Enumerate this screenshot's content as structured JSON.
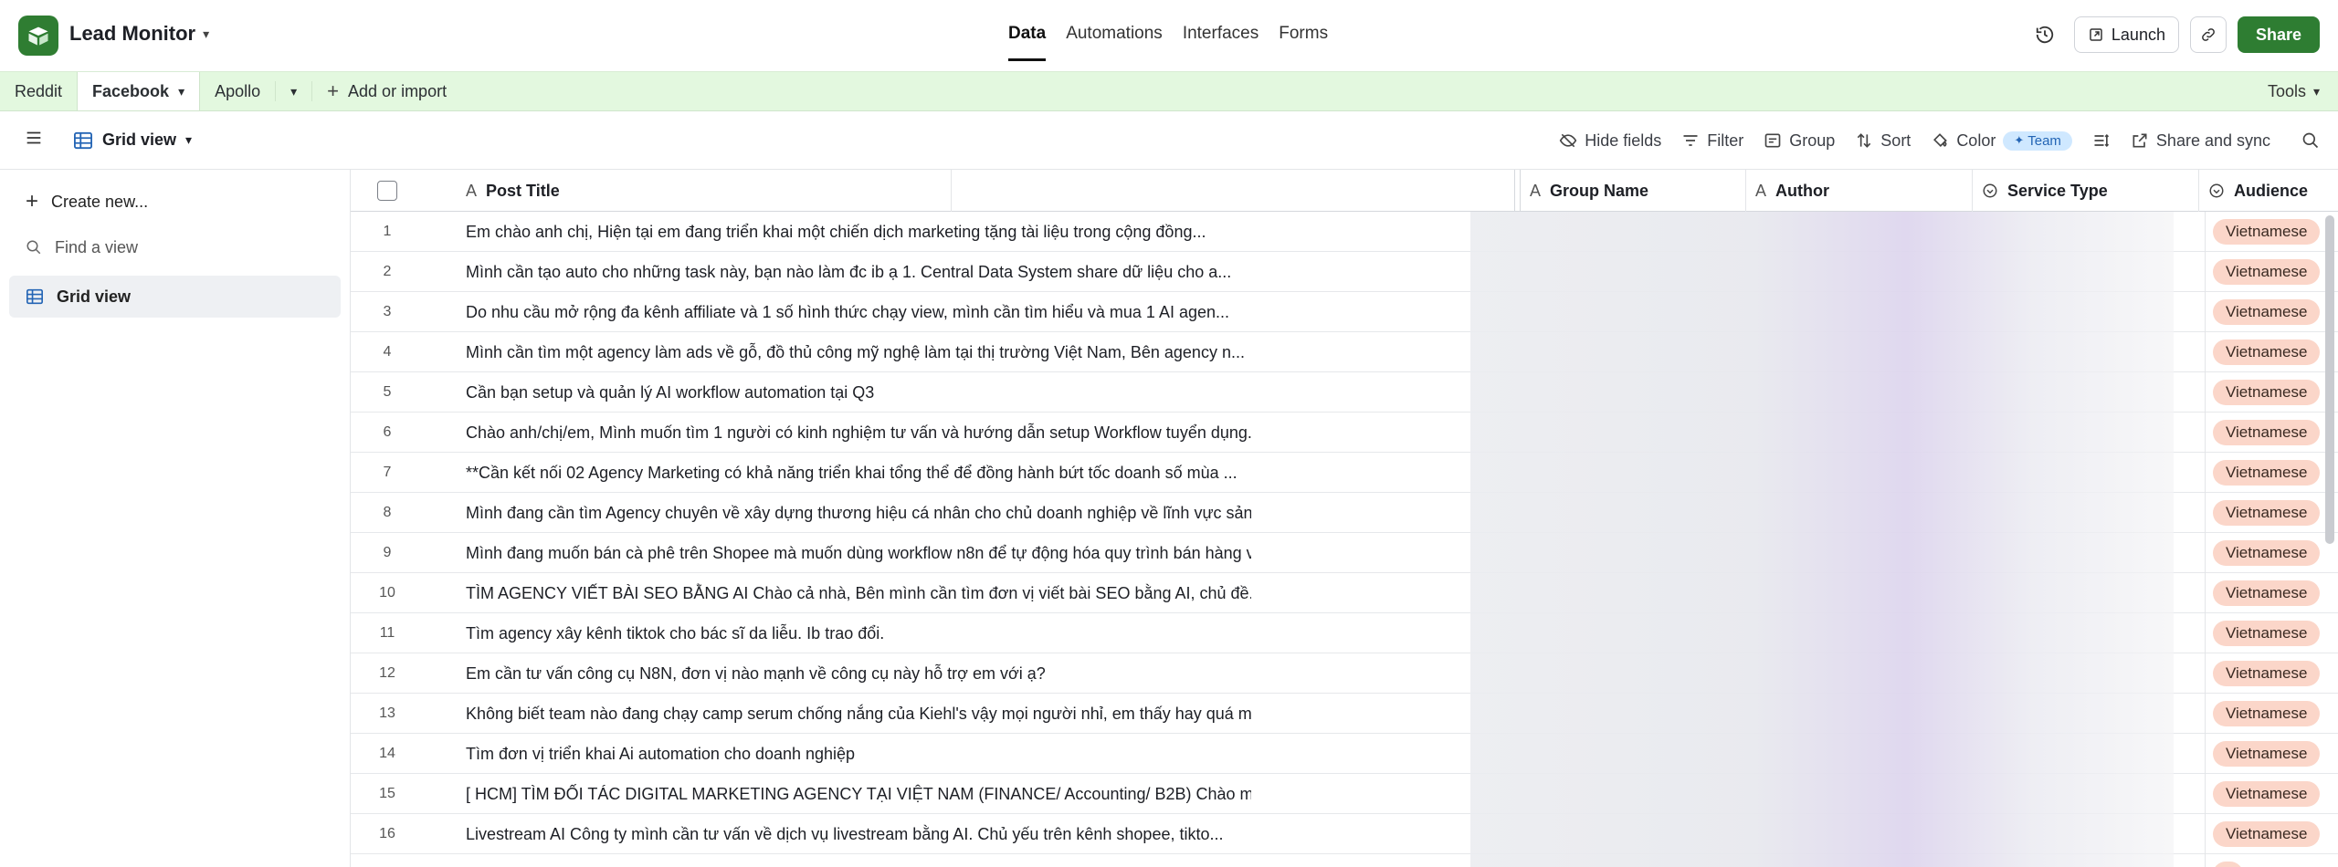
{
  "header": {
    "app_title": "Lead Monitor",
    "nav": [
      "Data",
      "Automations",
      "Interfaces",
      "Forms"
    ],
    "active_nav": "Data",
    "launch_label": "Launch",
    "share_label": "Share"
  },
  "tabs": {
    "items": [
      "Reddit",
      "Facebook",
      "Apollo"
    ],
    "active": "Facebook",
    "add_label": "Add or import",
    "tools_label": "Tools"
  },
  "viewbar": {
    "view_name": "Grid view",
    "hide_fields": "Hide fields",
    "filter": "Filter",
    "group": "Group",
    "sort": "Sort",
    "color": "Color",
    "team_badge": "Team",
    "share_sync": "Share and sync"
  },
  "sidebar": {
    "create_new": "Create new...",
    "find_view": "Find a view",
    "grid_view": "Grid view"
  },
  "columns": {
    "post_title": "Post Title",
    "group_name": "Group Name",
    "author": "Author",
    "service_type": "Service Type",
    "audience": "Audience"
  },
  "rows": [
    {
      "n": "1",
      "title": "Em chào anh chị, Hiện tại em đang triển khai một chiến dịch marketing tặng tài liệu trong cộng đồng...",
      "audience": "Vietnamese"
    },
    {
      "n": "2",
      "title": "Mình cần tạo auto cho những task này, bạn nào làm đc ib ạ 1. Central Data System share dữ liệu cho a...",
      "audience": "Vietnamese"
    },
    {
      "n": "3",
      "title": "Do nhu cầu mở rộng đa kênh affiliate và 1 số hình thức chạy view, mình cần tìm hiểu và mua 1 AI agen...",
      "audience": "Vietnamese"
    },
    {
      "n": "4",
      "title": "Mình cần tìm một agency làm ads về gỗ, đồ thủ công mỹ nghệ làm tại thị trường Việt Nam, Bên agency n...",
      "audience": "Vietnamese"
    },
    {
      "n": "5",
      "title": "Cần bạn setup và quản lý AI workflow automation tại Q3",
      "audience": "Vietnamese"
    },
    {
      "n": "6",
      "title": "Chào anh/chị/em, Mình muốn tìm 1 người có kinh nghiệm tư vấn và hướng dẫn setup Workflow tuyển dụng...",
      "audience": "Vietnamese"
    },
    {
      "n": "7",
      "title": "**Cần kết nối 02 Agency Marketing có khả năng triển khai tổng thể để đồng hành bứt tốc doanh số mùa ...",
      "audience": "Vietnamese"
    },
    {
      "n": "8",
      "title": "Mình đang cần tìm Agency chuyên về xây dựng thương hiệu cá nhân cho chủ doanh nghiệp về lĩnh vực sản...",
      "audience": "Vietnamese"
    },
    {
      "n": "9",
      "title": "Mình đang muốn bán cà phê trên Shopee mà muốn dùng workflow n8n để tự động hóa quy trình bán hàng và...",
      "audience": "Vietnamese"
    },
    {
      "n": "10",
      "title": "TÌM AGENCY VIẾT BÀI SEO BẰNG AI Chào cả nhà, Bên mình cần tìm đơn vị viết bài SEO bằng AI, chủ đề...",
      "audience": "Vietnamese"
    },
    {
      "n": "11",
      "title": "Tìm agency xây kênh tiktok cho bác sĩ da liễu. Ib trao đổi.",
      "audience": "Vietnamese"
    },
    {
      "n": "12",
      "title": "Em cần tư vấn công cụ N8N, đơn vị nào mạnh về công cụ này hỗ trợ em với ạ?",
      "audience": "Vietnamese"
    },
    {
      "n": "13",
      "title": "Không biết team nào đang chạy camp serum chống nắng của Kiehl's vậy mọi người nhỉ, em thấy hay quá m...",
      "audience": "Vietnamese"
    },
    {
      "n": "14",
      "title": "Tìm đơn vị triển khai Ai automation cho doanh nghiệp",
      "audience": "Vietnamese"
    },
    {
      "n": "15",
      "title": "[ HCM] TÌM ĐỐI TÁC DIGITAL MARKETING AGENCY TẠI VIỆT NAM (FINANCE/ Accounting/ B2B) Chào mọi người,...",
      "audience": "Vietnamese"
    },
    {
      "n": "16",
      "title": "Livestream AI Công ty mình cần tư vấn về dịch vụ livestream bằng AI. Chủ yếu trên kênh shopee, tikto...",
      "audience": "Vietnamese"
    }
  ],
  "colors": {
    "brand_green": "#2e7d32",
    "tab_bar_bg": "#e3f8df",
    "pill_bg": "#fbd6c9",
    "team_pill_bg": "#cfe8ff"
  }
}
